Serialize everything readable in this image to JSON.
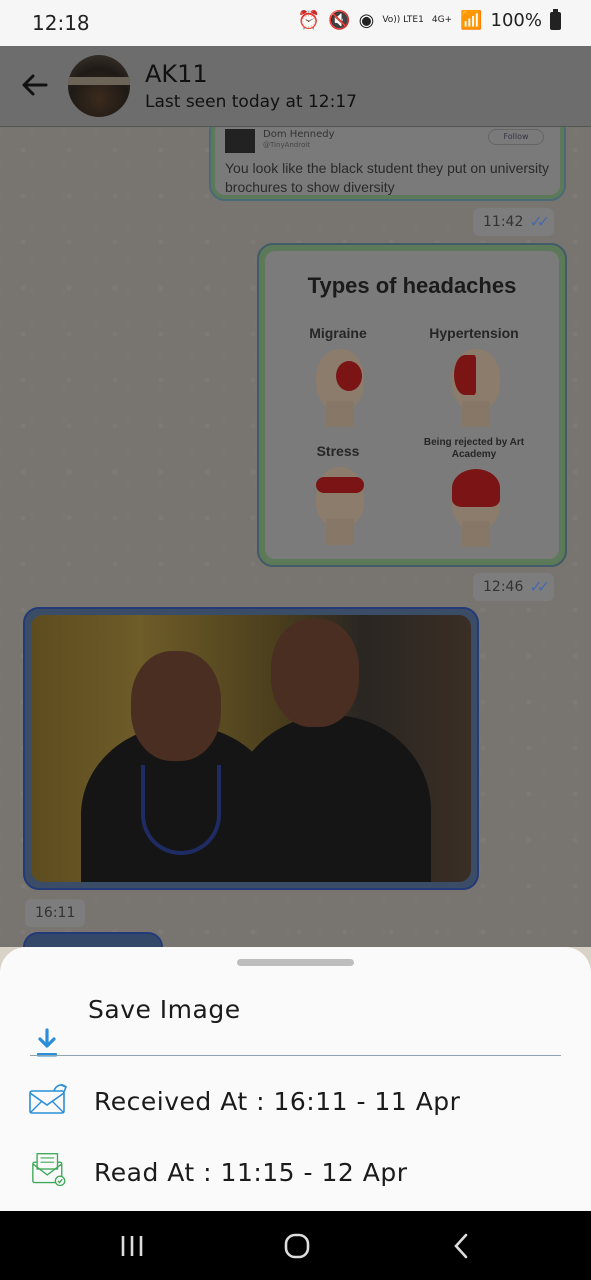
{
  "status_bar": {
    "time": "12:18",
    "network_label": "4G+",
    "lte_label": "Vo)) LTE1",
    "battery": "100%"
  },
  "header": {
    "contact_name": "AK11",
    "last_seen": "Last seen today at 12:17"
  },
  "messages": {
    "tweet": {
      "author": "Dom Hennedy",
      "handle": "@TinyAndroit",
      "follow_label": "Follow",
      "text": "You look like the black student they put on university brochures to show diversity",
      "time": "11:42"
    },
    "meme": {
      "title": "Types of headaches",
      "cells": [
        "Migraine",
        "Hypertension",
        "Stress",
        "Being rejected by Art Academy"
      ],
      "time": "12:46"
    },
    "photo": {
      "time": "16:11"
    }
  },
  "sheet": {
    "save_label": "Save Image",
    "received_label": "Received At : 16:11 - 11 Apr",
    "read_label": "Read At : 11:15 - 12 Apr"
  },
  "colors": {
    "accent_blue": "#2a8ed8",
    "read_green": "#3fa95a",
    "tick_blue": "#4a6aa8"
  }
}
